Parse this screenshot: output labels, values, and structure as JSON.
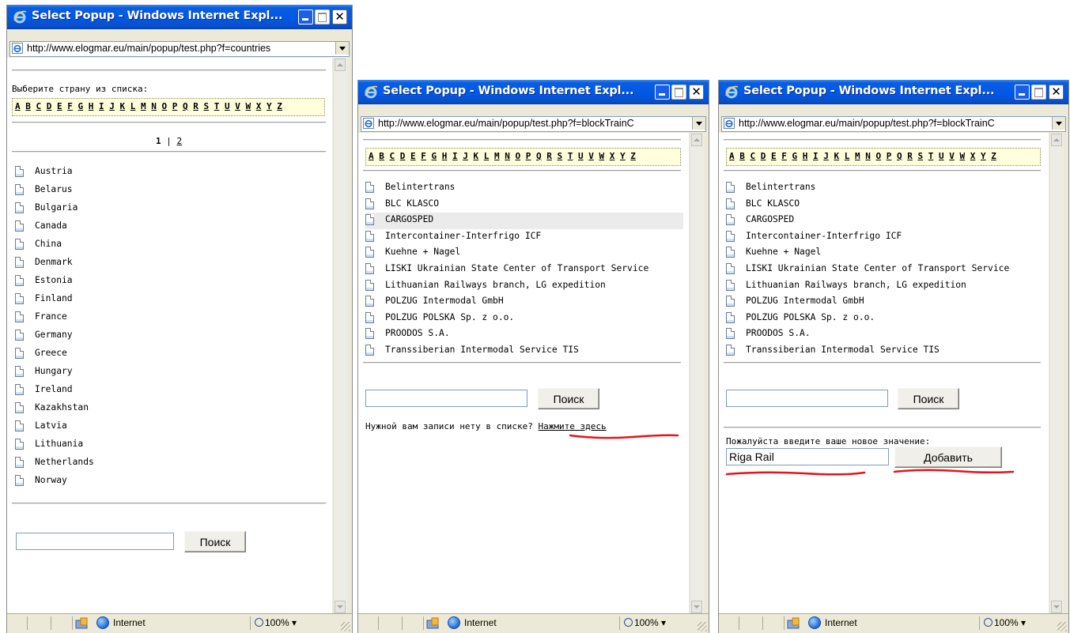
{
  "window_title": "Select Popup - Windows Internet Expl...",
  "addr": {
    "countries": "http://www.elogmar.eu/main/popup/test.php?f=countries",
    "blocks": "http://www.elogmar.eu/main/popup/test.php?f=blockTrainC"
  },
  "letters": [
    "A",
    "B",
    "C",
    "D",
    "E",
    "F",
    "G",
    "H",
    "I",
    "J",
    "K",
    "L",
    "M",
    "N",
    "O",
    "P",
    "Q",
    "R",
    "S",
    "T",
    "U",
    "V",
    "W",
    "X",
    "Y",
    "Z"
  ],
  "countries_window": {
    "instruction": "Выберите страну из списка:",
    "pager": {
      "current": "1",
      "sep": "|",
      "next": "2"
    },
    "items": [
      "Austria",
      "Belarus",
      "Bulgaria",
      "Canada",
      "China",
      "Denmark",
      "Estonia",
      "Finland",
      "France",
      "Germany",
      "Greece",
      "Hungary",
      "Ireland",
      "Kazakhstan",
      "Latvia",
      "Lithuania",
      "Netherlands",
      "Norway"
    ],
    "search_button": "Поиск"
  },
  "operators": [
    "Belintertrans",
    "BLC KLASCO",
    "CARGOSPED",
    "Intercontainer-Interfrigo ICF",
    "Kuehne + Nagel",
    "LISKI Ukrainian State Center of Transport Service",
    "Lithuanian Railways branch, LG expedition",
    "POLZUG Intermodal GmbH",
    "POLZUG POLSKA Sp. z o.o.",
    "PROODOS S.A.",
    "Transsiberian Intermodal Service TIS"
  ],
  "middle_window": {
    "search_button": "Поиск",
    "note": "Нужной вам записи нету в списке?",
    "note_link": "Нажмите здесь",
    "highlighted_item": "CARGOSPED"
  },
  "right_window": {
    "search_button": "Поиск",
    "new_value_label": "Пожалуйста введите ваше новое значение:",
    "new_value": "Riga Rail",
    "add_button": "Добавить"
  },
  "status": {
    "zone": "Internet",
    "zoom": "100%"
  },
  "colors": {
    "title_blue": "#0058e6",
    "letters_bg": "#ffffdc",
    "annotation_red": "#e8121a"
  }
}
